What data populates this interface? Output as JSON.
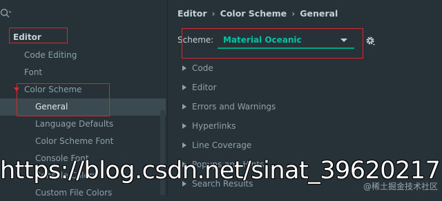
{
  "sidebar": {
    "search_glyph": "Q",
    "items": [
      {
        "label": "Editor"
      },
      {
        "label": "Code Editing"
      },
      {
        "label": "Font"
      },
      {
        "label": "Color Scheme"
      },
      {
        "label": "General"
      },
      {
        "label": "Language Defaults"
      },
      {
        "label": "Color Scheme Font"
      },
      {
        "label": "Console Font"
      },
      {
        "label": "Console Colors"
      },
      {
        "label": "Custom File Colors"
      }
    ]
  },
  "header": {
    "breadcrumb": [
      "Editor",
      "Color Scheme",
      "General"
    ],
    "separator": "›"
  },
  "scheme": {
    "label": "Scheme:",
    "value": "Material Oceanic"
  },
  "sections": [
    "Code",
    "Editor",
    "Errors and Warnings",
    "Hyperlinks",
    "Line Coverage",
    "Popups and Hints",
    "Search Results"
  ],
  "overlay": {
    "url_watermark": "https://blog.csdn.net/sinat_39620217",
    "corner_watermark": "@稀土掘金技术社区"
  },
  "colors": {
    "accent": "#00c3a5",
    "highlight_box": "#e0262c",
    "selection": "#3b4a51",
    "background": "#263238"
  }
}
